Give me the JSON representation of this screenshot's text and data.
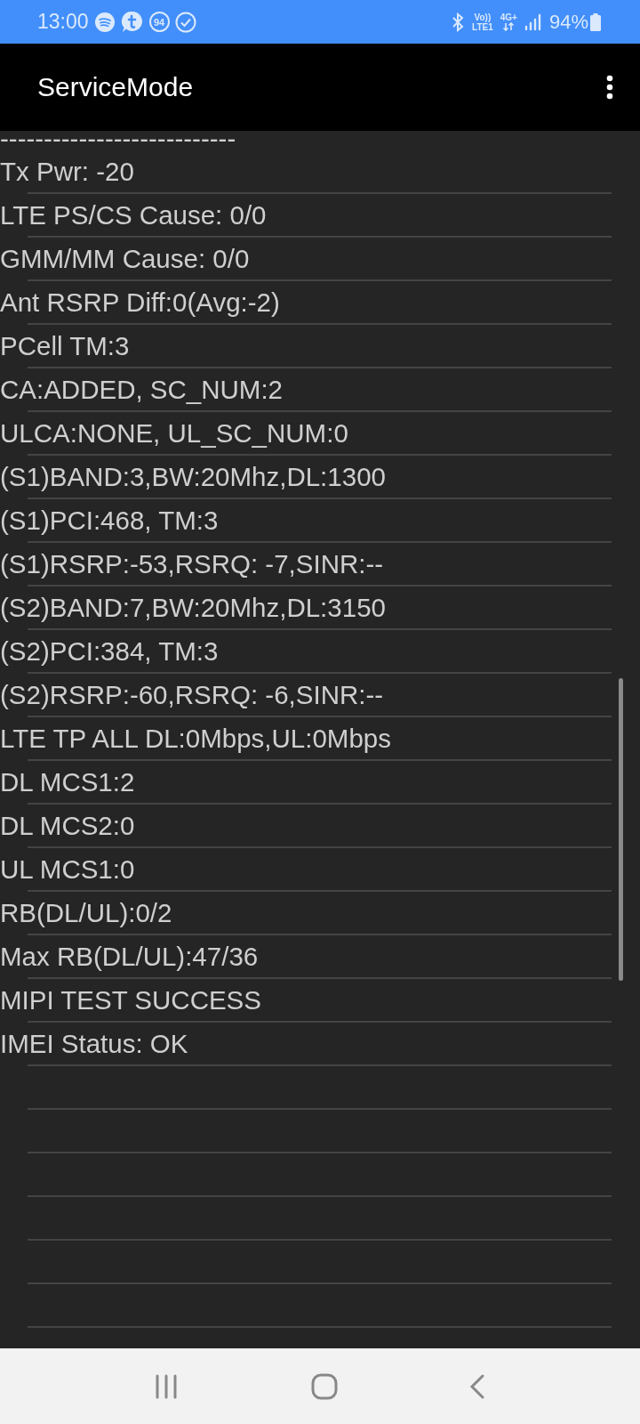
{
  "status_bar": {
    "time": "13:00",
    "badge_count": "94",
    "volte_top": "Vo))",
    "volte_bottom": "LTE1",
    "network": "4G+",
    "battery": "94%"
  },
  "app_bar": {
    "title": "ServiceMode"
  },
  "lines": [
    "---------------------------",
    "Tx Pwr: -20",
    "LTE PS/CS Cause: 0/0",
    "GMM/MM Cause: 0/0",
    "Ant RSRP Diff:0(Avg:-2)",
    "PCell TM:3",
    "CA:ADDED, SC_NUM:2",
    "ULCA:NONE, UL_SC_NUM:0",
    "(S1)BAND:3,BW:20Mhz,DL:1300",
    "(S1)PCI:468, TM:3",
    "(S1)RSRP:-53,RSRQ: -7,SINR:--",
    "(S2)BAND:7,BW:20Mhz,DL:3150",
    "(S2)PCI:384, TM:3",
    "(S2)RSRP:-60,RSRQ: -6,SINR:--",
    "LTE TP ALL DL:0Mbps,UL:0Mbps",
    "DL MCS1:2",
    "DL MCS2:0",
    "UL MCS1:0",
    "RB(DL/UL):0/2",
    "Max RB(DL/UL):47/36",
    "MIPI TEST SUCCESS",
    "IMEI Status: OK"
  ]
}
